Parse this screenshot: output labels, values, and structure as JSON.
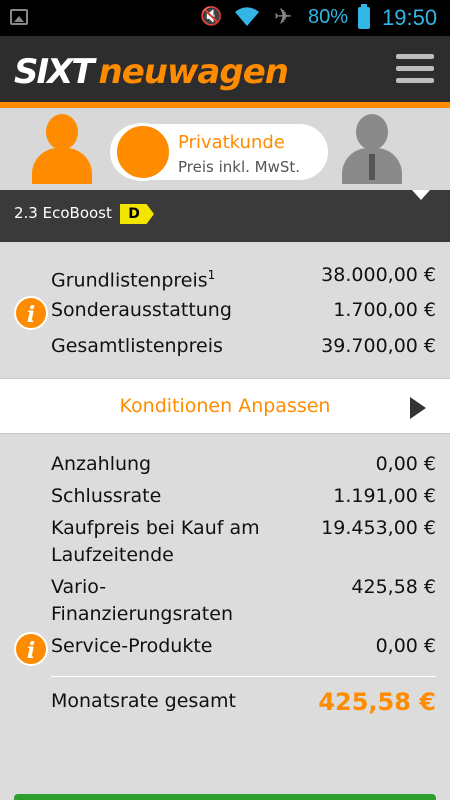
{
  "status": {
    "battery_pct": "80%",
    "time": "19:50"
  },
  "header": {
    "logo_part1": "SIXT",
    "logo_part2": "neuwagen"
  },
  "customer": {
    "title": "Privatkunde",
    "subtitle": "Preis inkl. MwSt."
  },
  "model": {
    "engine": "2.3 EcoBoost",
    "energy_class": "D"
  },
  "prices": [
    {
      "label": "Grundlistenpreis",
      "sup": "1",
      "value": "38.000,00 €"
    },
    {
      "label": "Sonderausstattung",
      "value": "1.700,00 €"
    },
    {
      "label": "Gesamtlistenpreis",
      "value": "39.700,00 €"
    }
  ],
  "conditions_button": "Konditionen Anpassen",
  "finance": [
    {
      "label": "Anzahlung",
      "value": "0,00 €"
    },
    {
      "label": "Schlussrate",
      "value": "1.191,00 €"
    },
    {
      "label": "Kaufpreis bei Kauf am Laufzeitende",
      "value": "19.453,00 €"
    },
    {
      "label": "Vario-Finanzierungsraten",
      "value": "425,58 €"
    },
    {
      "label": "Service-Produkte",
      "value": "0,00 €"
    }
  ],
  "total": {
    "label": "Monatsrate gesamt",
    "value": "425,58 €"
  },
  "colors": {
    "accent": "#ff8c00",
    "header": "#2d2d2d",
    "energy": "#f2e600"
  }
}
